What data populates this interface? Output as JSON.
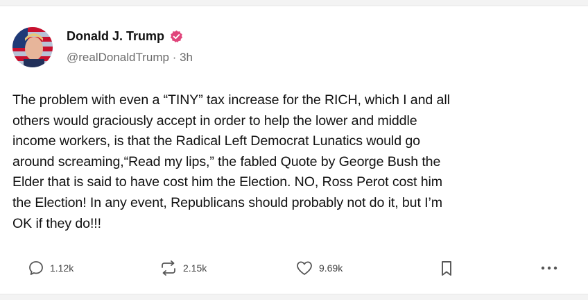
{
  "post": {
    "author": {
      "display_name": "Donald J. Trump",
      "handle": "@realDonaldTrump",
      "separator": " · ",
      "time_ago": "3h",
      "verified": true,
      "verified_color": "#e0457b"
    },
    "text_lines": [
      "The problem with even a “TINY” tax increase for the RICH, which I and all",
      "others would graciously accept in order to help the lower and middle",
      "income workers, is that the Radical Left Democrat Lunatics would go",
      "around screaming,“Read my lips,” the fabled Quote by George Bush the",
      "Elder that is said to have cost him the Election. NO, Ross Perot cost him",
      "the Election! In any event, Republicans should probably not do it, but I’m",
      "OK if they do!!!"
    ],
    "actions": {
      "reply_icon": "reply-icon",
      "reply_count": "1.12k",
      "repost_icon": "repost-icon",
      "repost_count": "2.15k",
      "like_icon": "heart-icon",
      "like_count": "9.69k",
      "bookmark_icon": "bookmark-icon",
      "more_icon": "more-options-icon"
    }
  }
}
